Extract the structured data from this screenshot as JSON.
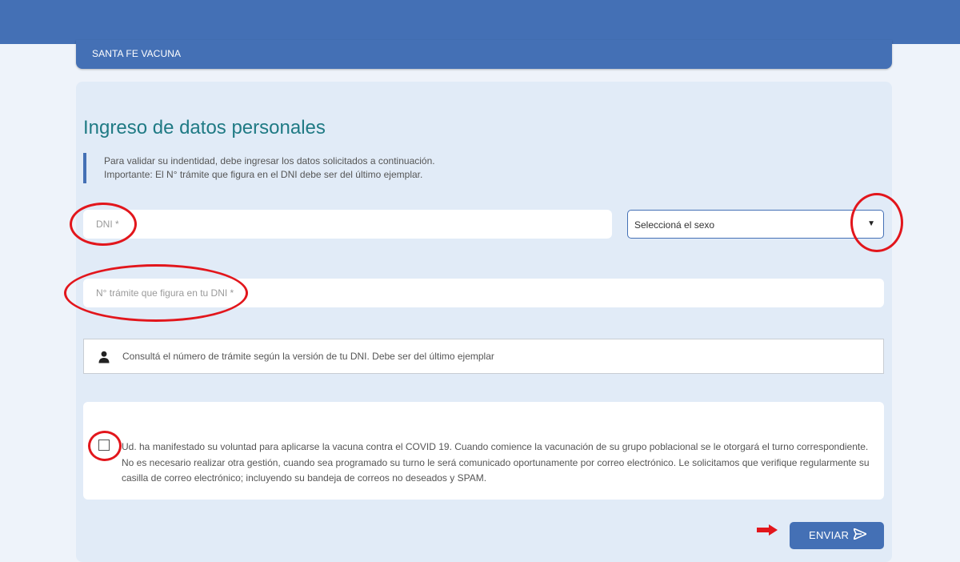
{
  "header": {
    "brand": "SANTA FE VACUNA",
    "color": "#4470b5"
  },
  "form": {
    "title": "Ingreso de datos personales",
    "notice": {
      "line1": "Para validar su indentidad, debe ingresar los datos solicitados a continuación.",
      "line2": "Importante: El N° trámite que figura en el DNI debe ser del último ejemplar."
    },
    "dni": {
      "placeholder": "DNI *",
      "value": ""
    },
    "sex_select": {
      "selected": "Seleccioná el sexo",
      "caret": "▼"
    },
    "tramite": {
      "placeholder": "N° trámite que figura en tu DNI *",
      "value": ""
    },
    "info": {
      "icon": "person-icon",
      "text": "Consultá el número de trámite según la versión de tu DNI. Debe ser del último ejemplar"
    },
    "consent": {
      "checked": false,
      "text": "Ud. ha manifestado su voluntad para aplicarse la vacuna contra el COVID 19. Cuando comience la vacunación de su grupo poblacional se le otorgará el turno correspondiente. No es necesario realizar otra gestión, cuando sea programado su turno le será comunicado oportunamente por correo electrónico. Le solicitamos que verifique regularmente su casilla de correo electrónico; incluyendo su bandeja de correos no deseados y SPAM."
    },
    "submit": {
      "label": "ENVIAR",
      "icon": "send-icon"
    }
  },
  "annotations": {
    "color": "#e2161c"
  }
}
